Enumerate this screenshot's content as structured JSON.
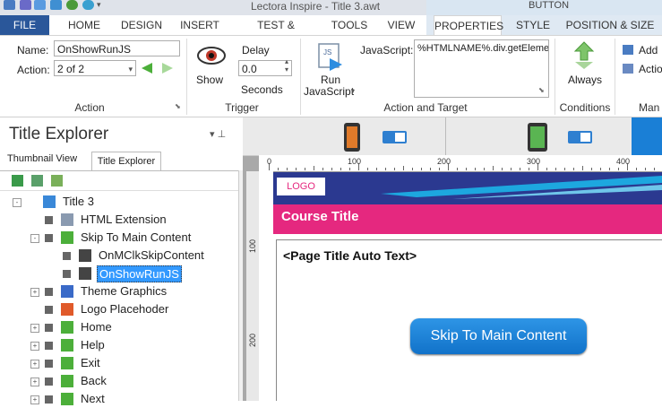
{
  "app": {
    "title": "Lectora Inspire - Title 3.awt",
    "context_label": "BUTTON"
  },
  "tabs": [
    "FILE",
    "HOME",
    "DESIGN",
    "INSERT",
    "TEST & SURVEY",
    "TOOLS",
    "VIEW",
    "PROPERTIES",
    "STYLE",
    "POSITION & SIZE"
  ],
  "ribbon": {
    "name_label": "Name:",
    "name_value": "OnShowRunJS",
    "action_label": "Action:",
    "action_value": "2 of 2",
    "show_label": "Show",
    "delay_label": "Delay",
    "delay_value": "0.0",
    "seconds_label": "Seconds",
    "run_js_label1": "Run",
    "run_js_label2": "JavaScript",
    "javascript_label": "JavaScript:",
    "javascript_value": "%HTMLNAME%.div.getEleme",
    "always_label": "Always",
    "add_label": "Add",
    "actions_label": "Actio",
    "groups": {
      "action": "Action",
      "trigger": "Trigger",
      "action_target": "Action and Target",
      "conditions": "Conditions",
      "manage": "Man"
    }
  },
  "explorer": {
    "title": "Title Explorer",
    "pin_glyph": "▾ ⊥",
    "subtabs": [
      "Thumbnail View",
      "Title Explorer"
    ],
    "tree": [
      {
        "label": "Title 3",
        "indent": 0,
        "icon": "page",
        "exp": "-"
      },
      {
        "label": "HTML Extension",
        "indent": 1,
        "icon": "html",
        "exp": ""
      },
      {
        "label": "Skip To Main Content",
        "indent": 1,
        "icon": "button",
        "exp": "-"
      },
      {
        "label": "OnMClkSkipContent",
        "indent": 2,
        "icon": "action",
        "exp": ""
      },
      {
        "label": "OnShowRunJS",
        "indent": 2,
        "icon": "action",
        "exp": "",
        "selected": true
      },
      {
        "label": "Theme Graphics",
        "indent": 1,
        "icon": "group",
        "exp": "+"
      },
      {
        "label": "Logo Placehoder",
        "indent": 1,
        "icon": "image",
        "exp": ""
      },
      {
        "label": "Home",
        "indent": 1,
        "icon": "button",
        "exp": "+"
      },
      {
        "label": "Help",
        "indent": 1,
        "icon": "button",
        "exp": "+"
      },
      {
        "label": "Exit",
        "indent": 1,
        "icon": "button",
        "exp": "+"
      },
      {
        "label": "Back",
        "indent": 1,
        "icon": "button",
        "exp": "+"
      },
      {
        "label": "Next",
        "indent": 1,
        "icon": "button",
        "exp": "+"
      }
    ]
  },
  "ruler": {
    "h": [
      "0",
      "100",
      "200",
      "300",
      "400"
    ],
    "v": [
      "100",
      "200"
    ]
  },
  "page": {
    "logo": "LOGO",
    "course_title": "Course Title",
    "page_title": "<Page Title Auto Text>",
    "skip_button": "Skip To Main Content"
  },
  "colors": {
    "accent": "#2a579a",
    "course_bar": "#e5287f",
    "header_blue": "#2b3990",
    "skip_button": "#1a7fd6",
    "selected": "#3399ff"
  }
}
